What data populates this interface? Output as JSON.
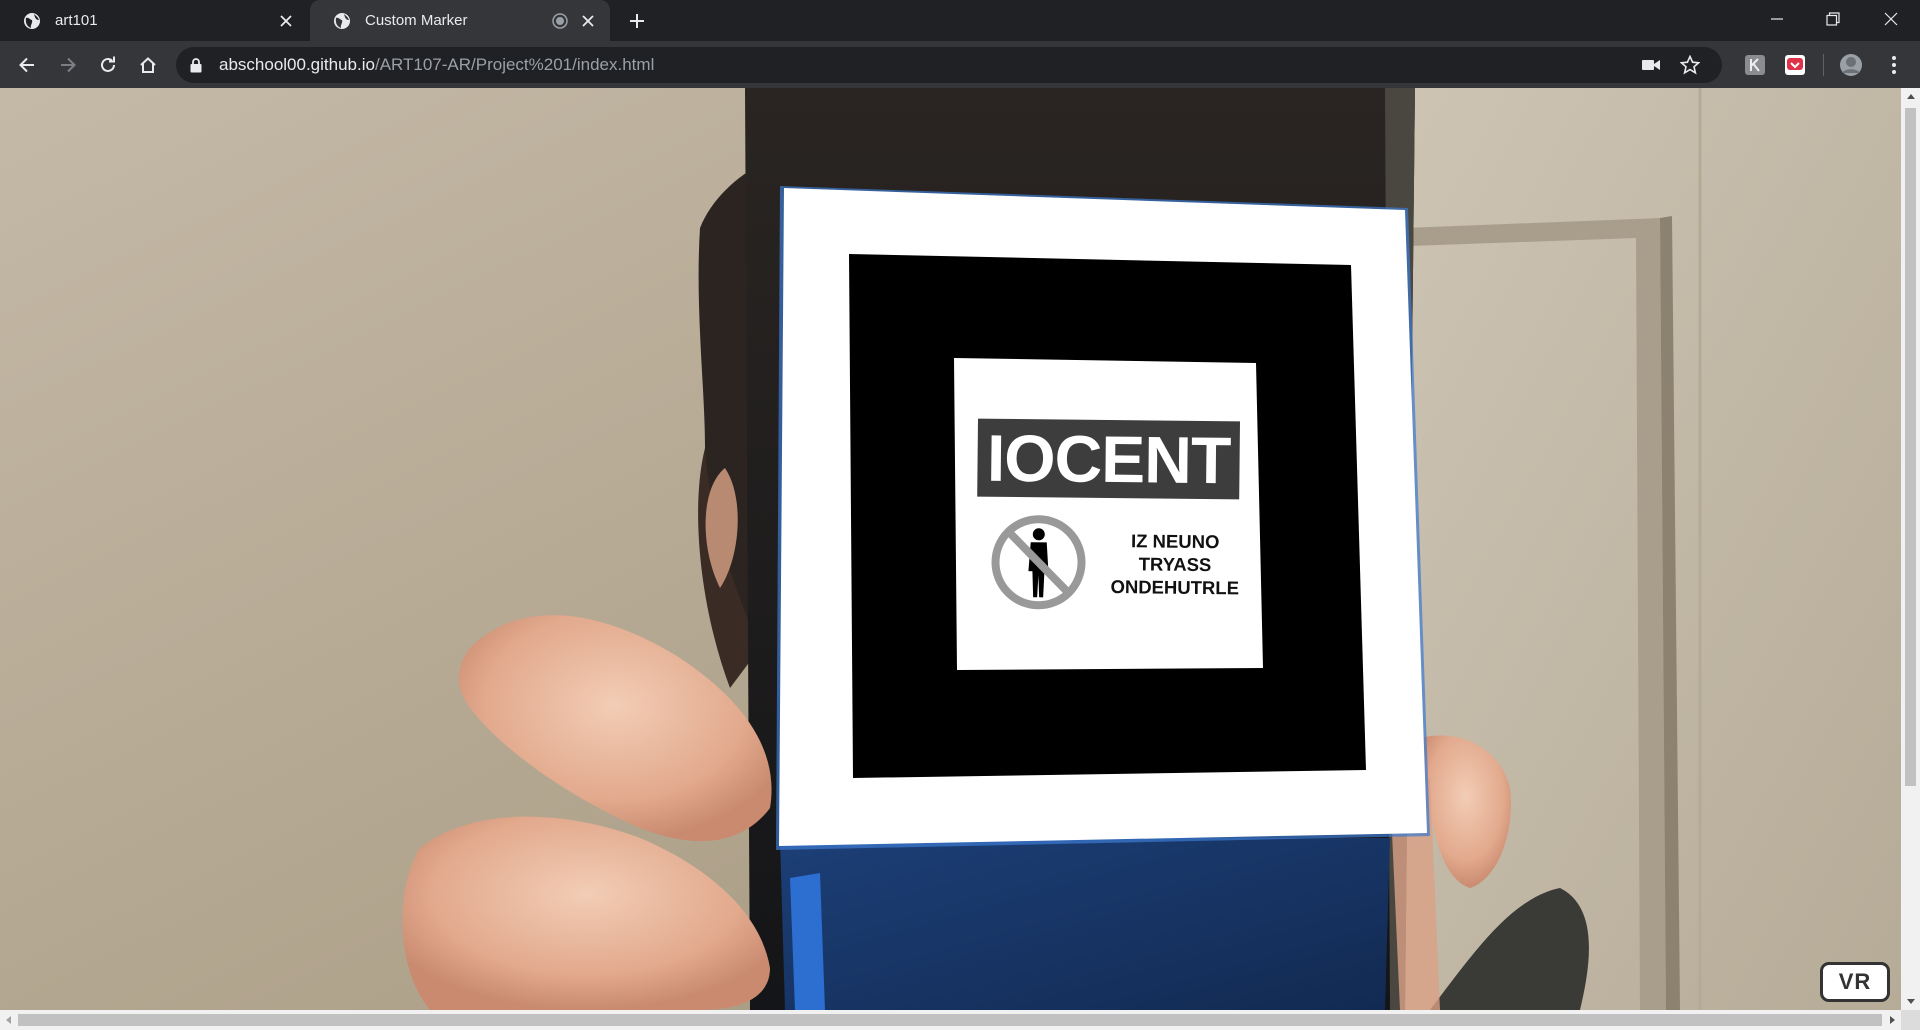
{
  "tabs": [
    {
      "title": "art101",
      "active": false
    },
    {
      "title": "Custom Marker",
      "active": true
    }
  ],
  "address_bar": {
    "host": "abschool00.github.io",
    "path": "/ART107-AR/Project%201/index.html"
  },
  "marker": {
    "heading": "IOCENT",
    "caption_line_1": "IZ NEUNO",
    "caption_line_2": "TRYASS",
    "caption_line_3": "ONDEHUTRLE",
    "sign_icon": "no-person-icon"
  },
  "vr_button": {
    "label": "VR"
  },
  "colors": {
    "chrome_dark": "#202124",
    "chrome_toolbar": "#35363a",
    "marker_heading_bg": "#3d3d3d",
    "phone_blue": "#1b4fa0"
  }
}
